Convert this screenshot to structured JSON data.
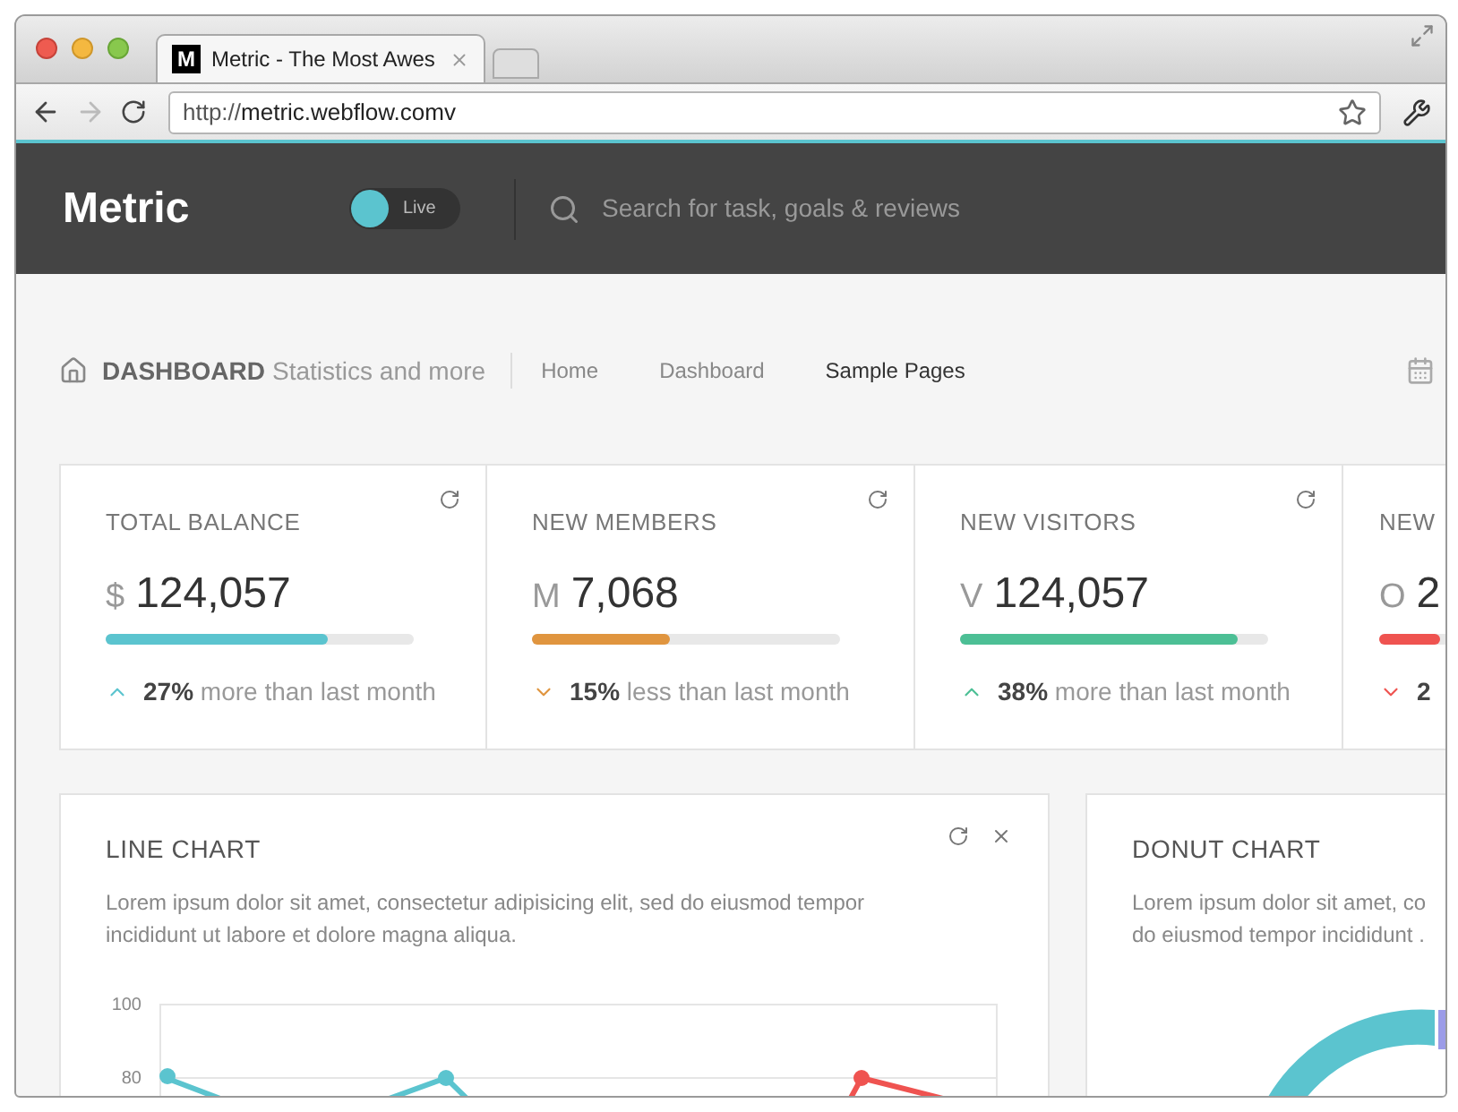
{
  "browser": {
    "tab_title": "Metric - The Most Awes",
    "favicon_letter": "M",
    "url_prefix": "http://",
    "url_host": "metric.webflow.comv",
    "tabs": [
      {
        "kind": "page",
        "selected": true
      },
      {
        "kind": "new",
        "selected": false
      }
    ]
  },
  "header": {
    "logo": "Metric",
    "live_toggle": {
      "label": "Live",
      "on": true
    },
    "search": {
      "placeholder": "Search for task, goals & reviews"
    }
  },
  "breadcrumb": {
    "title": "DASHBOARD",
    "subtitle": "Statistics and more",
    "links": [
      {
        "label": "Home",
        "selected": false
      },
      {
        "label": "Dashboard",
        "selected": false
      },
      {
        "label": "Sample Pages",
        "selected": true
      }
    ]
  },
  "stats": [
    {
      "title": "TOTAL BALANCE",
      "prefix": "$",
      "value": "124,057",
      "level": 0.72,
      "color": "#5bc4cf",
      "rising": true,
      "percent": "27%",
      "note": "more than last month"
    },
    {
      "title": "NEW MEMBERS",
      "prefix": "M",
      "value": "7,068",
      "level": 0.45,
      "color": "#e0953f",
      "rising": false,
      "percent": "15%",
      "note": "less than last month"
    },
    {
      "title": "NEW VISITORS",
      "prefix": "V",
      "value": "124,057",
      "level": 0.9,
      "color": "#4cbf95",
      "rising": true,
      "percent": "38%",
      "note": "more than last month"
    },
    {
      "title": "NEW",
      "prefix": "O",
      "value": "2",
      "level": 0.2,
      "color": "#ef5350",
      "rising": false,
      "percent": "2"
    }
  ],
  "line_chart": {
    "title": "LINE CHART",
    "description": "Lorem ipsum dolor sit amet, consectetur adipisicing elit, sed do eiusmod tempor incididunt ut labore et dolore magna aliqua.",
    "y_axis_labels": [
      "100",
      "80"
    ]
  },
  "donut_chart": {
    "title": "DONUT CHART",
    "description_lines": [
      "Lorem ipsum dolor sit amet, co",
      "do eiusmod tempor incididunt ."
    ]
  }
}
